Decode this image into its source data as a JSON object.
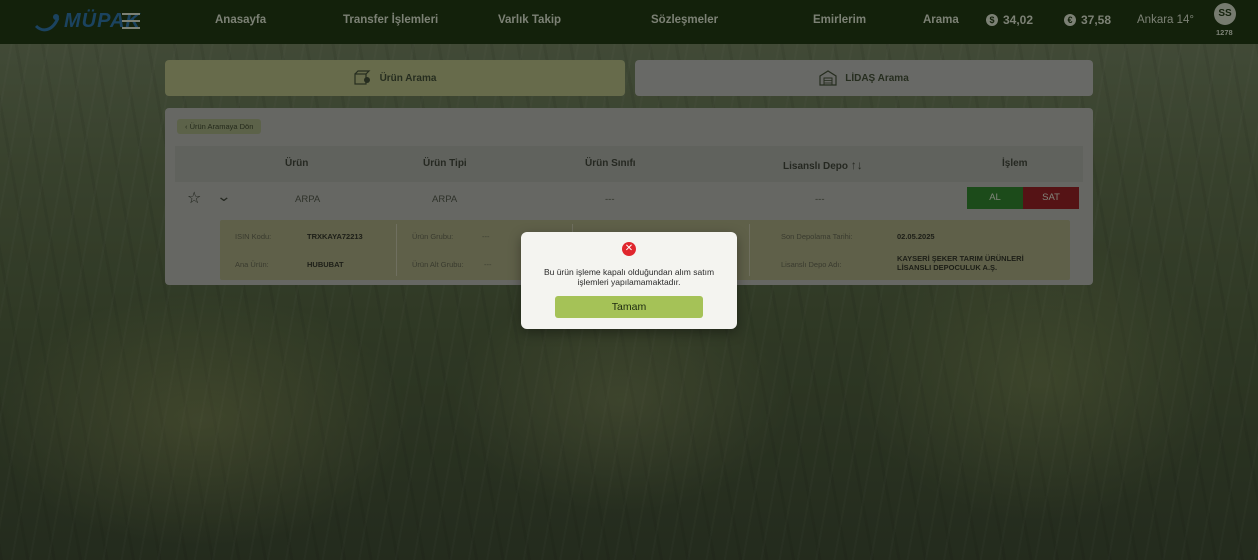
{
  "header": {
    "logo_text": "MÜPAK",
    "nav": [
      "Anasayfa",
      "Transfer İşlemleri",
      "Varlık Takip",
      "Sözleşmeler",
      "Emirlerim",
      "Arama"
    ],
    "prices": [
      {
        "symbol": "$",
        "value": "34,02"
      },
      {
        "symbol": "€",
        "value": "37,58"
      }
    ],
    "weather": "Ankara 14°",
    "user_initials": "SS",
    "user_number": "1278"
  },
  "tabs": [
    {
      "label": "Ürün Arama",
      "icon": "box-search-icon",
      "active": true
    },
    {
      "label": "LİDAŞ Arama",
      "icon": "warehouse-icon",
      "active": false
    }
  ],
  "panel": {
    "back_label": "Ürün Aramaya Dön",
    "columns": [
      "Ürün",
      "Ürün Tipi",
      "Ürün Sınıfı",
      "Lisanslı Depo",
      "İşlem"
    ],
    "row": {
      "urun": "ARPA",
      "urun_tipi": "ARPA",
      "urun_sinifi": "---",
      "lisansli_depo": "---",
      "buy_label": "AL",
      "sell_label": "SAT"
    },
    "detail": {
      "isin_label": "ISIN Kodu:",
      "isin_value": "TRXKAYA72213",
      "ana_urun_label": "Ana Ürün:",
      "ana_urun_value": "HUBUBAT",
      "urun_grubu_label": "Ürün Grubu:",
      "urun_grubu_value": "---",
      "urun_alt_grubu_label": "Ürün Alt Grubu:",
      "urun_alt_grubu_value": "---",
      "son_depolama_label": "Son Depolama Tarihi:",
      "son_depolama_value": "02.05.2025",
      "depo_adi_label": "Lisanslı Depo Adı:",
      "depo_adi_value_1": "KAYSERİ ŞEKER TARIM ÜRÜNLERİ",
      "depo_adi_value_2": "LİSANSLI DEPOCULUK A.Ş."
    }
  },
  "modal": {
    "message": "Bu ürün işleme kapalı olduğundan alım satım işlemleri yapılamamaktadır.",
    "ok_label": "Tamam"
  },
  "colors": {
    "header_bg": "#1f3612",
    "buy": "#2e7a2a",
    "sell": "#8a1f23",
    "ok_button": "#a5c257",
    "error": "#e0262d"
  }
}
